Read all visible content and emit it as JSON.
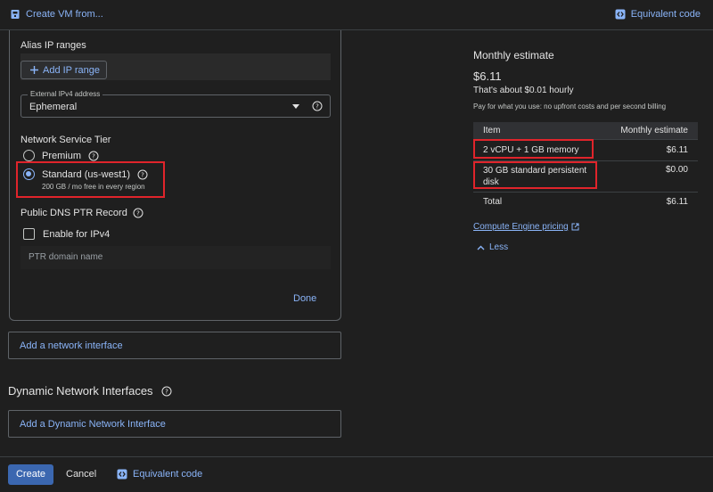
{
  "header": {
    "create_vm_from": "Create VM from...",
    "equivalent_code": "Equivalent code"
  },
  "network": {
    "alias_ip_title": "Alias IP ranges",
    "add_ip_range": "Add IP range",
    "ipv4_label": "External IPv4 address",
    "ipv4_value": "Ephemeral",
    "tier_title": "Network Service Tier",
    "tier_premium": "Premium",
    "tier_standard": "Standard (us-west1)",
    "tier_standard_sub": "200 GB / mo free in every region",
    "selected_tier": "Standard (us-west1)",
    "dns_title": "Public DNS PTR Record",
    "enable_ipv4": "Enable for IPv4",
    "enable_ipv4_checked": false,
    "ptr_placeholder": "PTR domain name",
    "done": "Done"
  },
  "add_network_interface": "Add a network interface",
  "dynamic": {
    "title": "Dynamic Network Interfaces",
    "add_button": "Add a Dynamic Network Interface"
  },
  "footer": {
    "create": "Create",
    "cancel": "Cancel",
    "equivalent_code": "Equivalent code"
  },
  "estimate": {
    "title": "Monthly estimate",
    "price": "$6.11",
    "hourly": "That's about $0.01 hourly",
    "note": "Pay for what you use: no upfront costs and per second billing",
    "columns": [
      "Item",
      "Monthly estimate"
    ],
    "rows": [
      {
        "item": "2 vCPU + 1 GB memory",
        "cost": "$6.11"
      },
      {
        "item": "30 GB standard persistent disk",
        "cost": "$0.00"
      },
      {
        "item": "Total",
        "cost": "$6.11"
      }
    ],
    "pricing_link": "Compute Engine pricing",
    "less": "Less"
  },
  "colors": {
    "accent": "#8ab4f8",
    "primary_button": "#3b67b0",
    "highlight": "#e0242b",
    "background": "#1f1f1f"
  },
  "icons": [
    "document-icon",
    "code-icon",
    "plus-icon",
    "dropdown-arrow-icon",
    "help-icon",
    "external-link-icon",
    "chevron-up-icon"
  ]
}
